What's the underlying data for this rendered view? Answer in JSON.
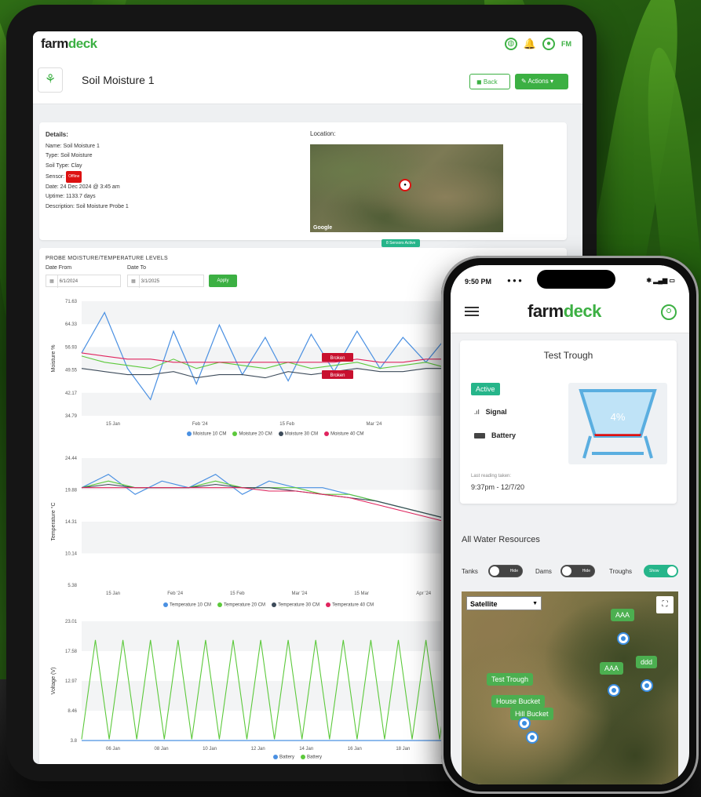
{
  "tablet": {
    "brand": {
      "prefix": "farm",
      "suffix": "deck"
    },
    "header_initials": "FM",
    "page_title": "Soil Moisture 1",
    "back_label": "Back",
    "actions_label": "Actions",
    "details": {
      "heading": "Details:",
      "name": "Name: Soil Moisture 1",
      "type": "Type: Soil Moisture",
      "soil_type": "Soil Type: Clay",
      "sensor_label": "Sensor:",
      "sensor_status": "Offline",
      "date": "Date: 24 Dec 2024 @ 3:45 am",
      "uptime": "Uptime: 1133.7 days",
      "description": "Description: Soil Moisture Probe 1"
    },
    "location_label": "Location:",
    "map_attribution": "Google",
    "sensors_active": "8 Sensors Active",
    "probe": {
      "title": "PROBE MOISTURE/TEMPERATURE LEVELS",
      "date_from_label": "Date From",
      "date_to_label": "Date To",
      "date_from": "6/1/2024",
      "date_to": "3/1/2025",
      "apply_label": "Apply"
    },
    "legend_moisture": [
      "Moisture 10 CM",
      "Moisture 20 CM",
      "Moisture 30 CM",
      "Moisture 40 CM"
    ],
    "legend_temperature": [
      "Temperature 10 CM",
      "Temperature 20 CM",
      "Temperature 30 CM",
      "Temperature 40 CM"
    ],
    "legend_voltage": [
      "Battery",
      "Battery"
    ],
    "series_colors": [
      "#4a90e2",
      "#5cc93b",
      "#3d4b5a",
      "#e0245e"
    ],
    "broken_labels": [
      "Broken",
      "Broken"
    ]
  },
  "chart_data": [
    {
      "type": "line",
      "ylabel": "Moisture %",
      "yticks": [
        "71.63",
        "64.33",
        "56.93",
        "49.55",
        "42.17",
        "34.79"
      ],
      "ylim": [
        34.79,
        71.63
      ],
      "xticks": [
        "15 Jan",
        "Feb '24",
        "15 Feb",
        "Mar '24",
        "15 Mar",
        "A"
      ],
      "series": [
        {
          "name": "Moisture 10 CM",
          "values": [
            55,
            68,
            50,
            40,
            62,
            45,
            64,
            48,
            60,
            46,
            61,
            49,
            62,
            50,
            60,
            52,
            61,
            50,
            58,
            48,
            44,
            60
          ]
        },
        {
          "name": "Moisture 20 CM",
          "values": [
            54,
            52,
            51,
            50,
            53,
            50,
            52,
            51,
            50,
            52,
            50,
            51,
            52,
            50,
            51,
            52,
            50,
            51,
            52,
            51,
            50,
            51
          ]
        },
        {
          "name": "Moisture 30 CM",
          "values": [
            50,
            49,
            48,
            48,
            49,
            47,
            48,
            48,
            47,
            49,
            48,
            49,
            50,
            49,
            49,
            50,
            50,
            51,
            51,
            52,
            52,
            52
          ]
        },
        {
          "name": "Moisture 40 CM",
          "values": [
            55,
            54,
            53,
            53,
            52,
            52,
            52,
            52,
            52,
            52,
            52,
            52,
            53,
            52,
            52,
            53,
            53,
            53,
            53,
            53,
            53,
            53
          ]
        }
      ]
    },
    {
      "type": "line",
      "ylabel": "Temperature °C",
      "yticks": [
        "24.44",
        "19.88",
        "14.31",
        "10.14",
        "5.38"
      ],
      "ylim": [
        5.38,
        24.44
      ],
      "xticks": [
        "15 Jan",
        "Feb '24",
        "15 Feb",
        "Mar '24",
        "15 Mar",
        "Apr '24",
        "15 Apr",
        "Ma"
      ],
      "series": [
        {
          "name": "Temperature 10 CM",
          "values": [
            20,
            22,
            19,
            21,
            20,
            22,
            19,
            21,
            20,
            20,
            19,
            18,
            17,
            16,
            15,
            14,
            13,
            12,
            11
          ]
        },
        {
          "name": "Temperature 20 CM",
          "values": [
            20,
            21,
            20,
            20,
            20,
            21,
            20,
            20,
            20,
            19,
            19,
            18,
            17,
            16,
            15,
            14,
            13,
            12,
            11
          ]
        },
        {
          "name": "Temperature 30 CM",
          "values": [
            20,
            20.5,
            20,
            20,
            20,
            20.5,
            20,
            20,
            19.5,
            19,
            18.5,
            18,
            17,
            16,
            15,
            14,
            13,
            12,
            11
          ]
        },
        {
          "name": "Temperature 40 CM",
          "values": [
            20,
            20,
            20,
            20,
            20,
            20,
            20,
            19.5,
            19.5,
            19,
            18.5,
            17.5,
            16.5,
            15.5,
            14.5,
            13.5,
            12.5,
            11.5,
            10.8
          ]
        }
      ]
    },
    {
      "type": "line",
      "ylabel": "Voltage (V)",
      "yticks": [
        "23.01",
        "17.58",
        "12.97",
        "8.46",
        "3.8"
      ],
      "ylim": [
        3.8,
        23.01
      ],
      "xticks": [
        "06 Jan",
        "08 Jan",
        "10 Jan",
        "12 Jan",
        "14 Jan",
        "16 Jan",
        "18 Jan",
        "20 Jan",
        "22 Jan",
        "24 Jan"
      ],
      "series": [
        {
          "name": "Battery",
          "values": [
            3.8,
            3.8,
            3.8,
            3.8,
            3.8,
            3.8,
            3.8,
            3.8,
            3.8,
            3.8
          ]
        },
        {
          "name": "Battery",
          "values": [
            4,
            20,
            4,
            20,
            4,
            20,
            4,
            20,
            4,
            20,
            4,
            20,
            4,
            20,
            4,
            20,
            4,
            20,
            4,
            20,
            4,
            20,
            4,
            20,
            4,
            20,
            4,
            20,
            4,
            20,
            4,
            20,
            4,
            20,
            4,
            20
          ]
        }
      ]
    }
  ],
  "phone": {
    "status_time": "9:50 PM",
    "brand": {
      "prefix": "farm",
      "suffix": "deck"
    },
    "trough": {
      "title": "Test Trough",
      "status": "Active",
      "signal_label": "Signal",
      "battery_label": "Battery",
      "level_text": "4%",
      "level_value": 4,
      "last_reading_label": "Last reading taken:",
      "last_reading_value": "9:37pm - 12/7/20"
    },
    "section_title": "All Water Resources",
    "toggles": [
      {
        "label": "Tanks",
        "state": "Hide"
      },
      {
        "label": "Dams",
        "state": "Hide"
      },
      {
        "label": "Troughs",
        "state": "Show"
      }
    ],
    "map_type": "Satellite",
    "markers": [
      "AAA",
      "AAA",
      "ddd",
      "Test Trough",
      "House Bucket",
      "Hill Bucket"
    ]
  }
}
